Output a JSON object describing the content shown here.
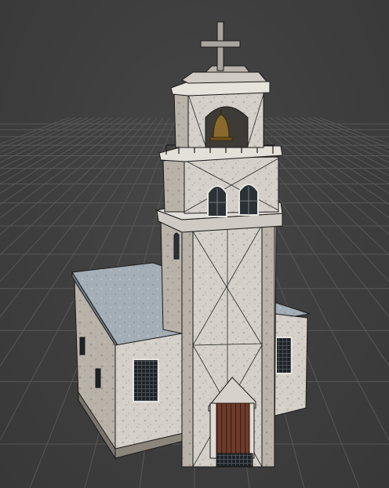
{
  "viewport": {
    "background_color": "#3c3c3c",
    "grid_color": "#5a5a5a",
    "wire_color": "#1a1a1a"
  },
  "model": {
    "icons": [
      "cross-icon",
      "bell-icon"
    ],
    "colors": {
      "stone_light": "#d9d5cf",
      "stone_mid": "#bfb9b1",
      "stone_dark": "#9c958d",
      "roof": "#9aa6b0",
      "roof_dark": "#7f8b95",
      "door": "#6b3a2a",
      "window_glass": "#2a3238",
      "cross": "#a9a49d"
    }
  }
}
